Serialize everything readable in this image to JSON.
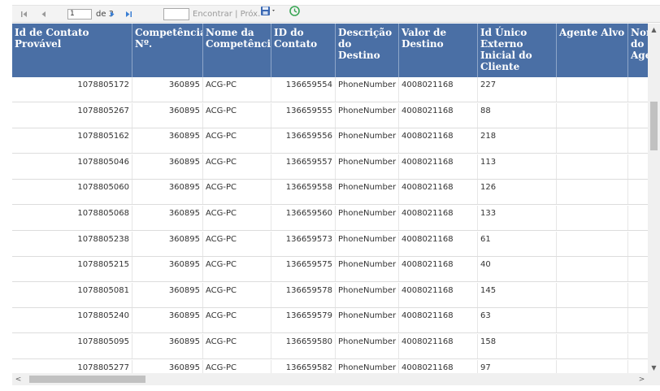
{
  "toolbar": {
    "page_value": "1",
    "page_of": "de 3",
    "find_value": "",
    "find_label": "Encontrar",
    "separator": " | ",
    "next_label": "Próx.",
    "icons": {
      "first": "first-page-icon",
      "prev": "previous-page-icon",
      "next": "next-page-icon",
      "last": "last-page-icon",
      "export": "export-save-icon",
      "refresh": "refresh-icon"
    }
  },
  "table": {
    "columns": [
      "Id de Contato Provável",
      "Competência Nº.",
      "Nome da Competência",
      "ID do Contato",
      "Descrição do Destino",
      "Valor de Destino",
      "Id Único Externo Inicial do Cliente",
      "Agente Alvo",
      "Nome do Agente"
    ],
    "rows": [
      [
        "1078805172",
        "360895",
        "ACG-PC",
        "136659554",
        "PhoneNumber",
        "4008021168",
        "227",
        "",
        ""
      ],
      [
        "1078805267",
        "360895",
        "ACG-PC",
        "136659555",
        "PhoneNumber",
        "4008021168",
        "88",
        "",
        ""
      ],
      [
        "1078805162",
        "360895",
        "ACG-PC",
        "136659556",
        "PhoneNumber",
        "4008021168",
        "218",
        "",
        ""
      ],
      [
        "1078805046",
        "360895",
        "ACG-PC",
        "136659557",
        "PhoneNumber",
        "4008021168",
        "113",
        "",
        ""
      ],
      [
        "1078805060",
        "360895",
        "ACG-PC",
        "136659558",
        "PhoneNumber",
        "4008021168",
        "126",
        "",
        ""
      ],
      [
        "1078805068",
        "360895",
        "ACG-PC",
        "136659560",
        "PhoneNumber",
        "4008021168",
        "133",
        "",
        ""
      ],
      [
        "1078805238",
        "360895",
        "ACG-PC",
        "136659573",
        "PhoneNumber",
        "4008021168",
        "61",
        "",
        ""
      ],
      [
        "1078805215",
        "360895",
        "ACG-PC",
        "136659575",
        "PhoneNumber",
        "4008021168",
        "40",
        "",
        ""
      ],
      [
        "1078805081",
        "360895",
        "ACG-PC",
        "136659578",
        "PhoneNumber",
        "4008021168",
        "145",
        "",
        ""
      ],
      [
        "1078805240",
        "360895",
        "ACG-PC",
        "136659579",
        "PhoneNumber",
        "4008021168",
        "63",
        "",
        ""
      ],
      [
        "1078805095",
        "360895",
        "ACG-PC",
        "136659580",
        "PhoneNumber",
        "4008021168",
        "158",
        "",
        ""
      ],
      [
        "1078805277",
        "360895",
        "ACG-PC",
        "136659582",
        "PhoneNumber",
        "4008021168",
        "97",
        "",
        ""
      ]
    ]
  },
  "colors": {
    "header_bg": "#4a6fa5",
    "header_text": "#ffffff",
    "nav_arrow": "#3b7fd4"
  }
}
